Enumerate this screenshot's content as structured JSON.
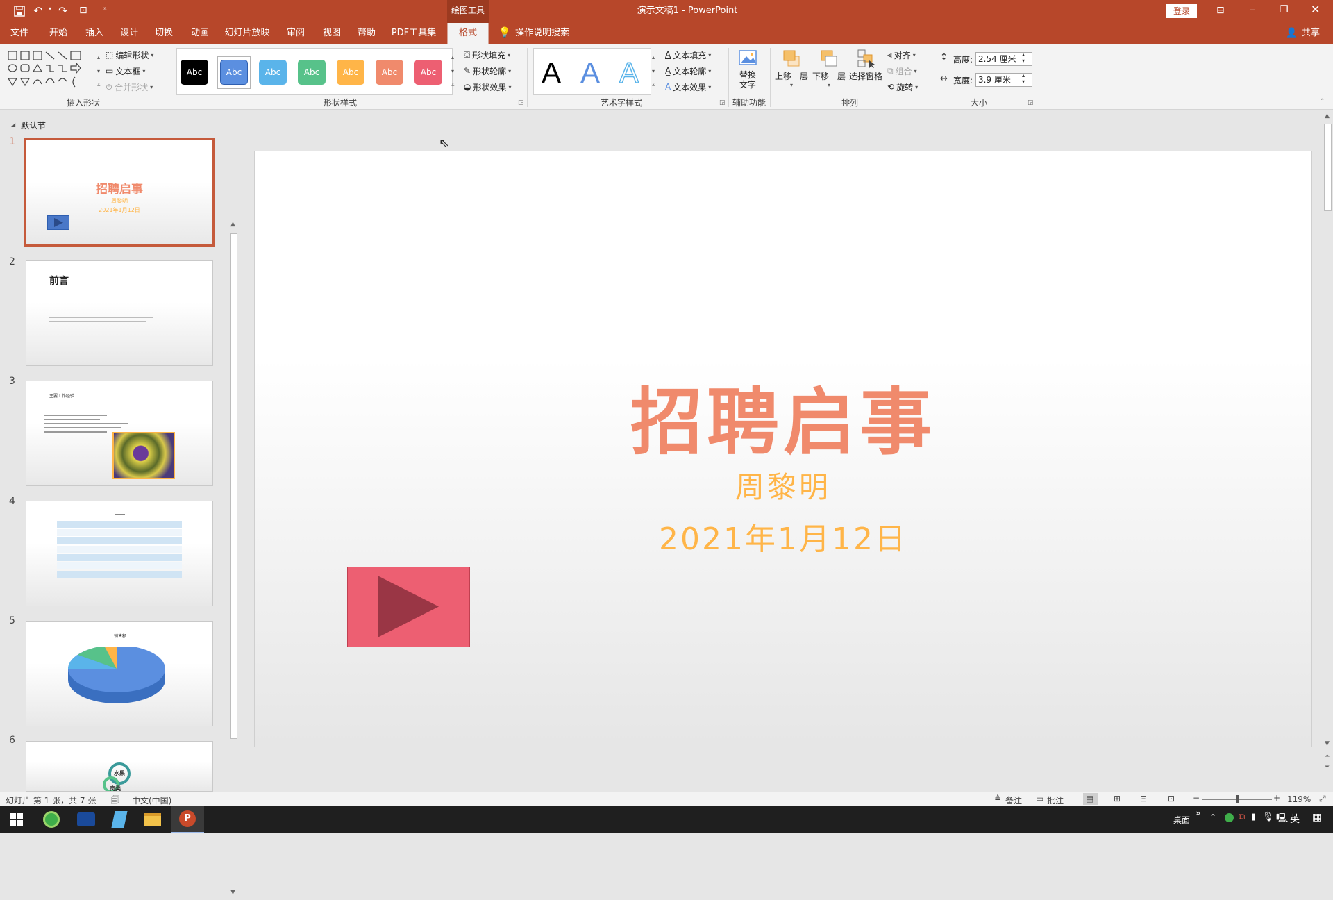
{
  "window": {
    "context_tool": "绘图工具",
    "doc_title": "演示文稿1 - PowerPoint",
    "login": "登录"
  },
  "tabs": [
    "文件",
    "开始",
    "插入",
    "设计",
    "切换",
    "动画",
    "幻灯片放映",
    "审阅",
    "视图",
    "帮助",
    "PDF工具集",
    "格式"
  ],
  "search_hint": "操作说明搜索",
  "share": "共享",
  "ribbon": {
    "insert_shapes": {
      "label": "插入形状",
      "edit_shape": "编辑形状",
      "text_box": "文本框",
      "merge_shapes": "合并形状"
    },
    "shape_styles": {
      "label": "形状样式",
      "swatch_text": "Abc",
      "swatch_colors": [
        "#000000",
        "#5b8fe0",
        "#5ab4ea",
        "#57c28a",
        "#ffb548",
        "#f08a6c",
        "#ed5f72"
      ],
      "fill": "形状填充",
      "outline": "形状轮廓",
      "effects": "形状效果"
    },
    "wordart": {
      "label": "艺术字样式",
      "letter": "A",
      "fill": "文本填充",
      "outline": "文本轮廓",
      "effects": "文本效果"
    },
    "accessibility": {
      "label": "辅助功能",
      "alt_text_1": "替换",
      "alt_text_2": "文字"
    },
    "arrange": {
      "label": "排列",
      "bring_forward": "上移一层",
      "send_backward": "下移一层",
      "selection_pane": "选择窗格",
      "align": "对齐",
      "group": "组合",
      "rotate": "旋转"
    },
    "size": {
      "label": "大小",
      "height_label": "高度:",
      "height_value": "2.54 厘米",
      "width_label": "宽度:",
      "width_value": "3.9 厘米"
    }
  },
  "thumbnails": {
    "section": "默认节",
    "nums": [
      "1",
      "2",
      "3",
      "4",
      "5",
      "6"
    ],
    "t1": {
      "title": "招聘启事",
      "name": "周黎明",
      "date": "2021年1月12日"
    },
    "t2": {
      "title": "前言"
    },
    "t3": {
      "title": "主要工作经验"
    },
    "t5": {
      "title": "销售额"
    },
    "t6": {
      "labels": [
        "水果",
        "肉类"
      ]
    }
  },
  "slide": {
    "title": "招聘启事",
    "subtitle": "周黎明",
    "date": "2021年1月12日",
    "title_color": "#f08a6c",
    "sub_color": "#ffb548",
    "shape_color": "#ed5f72"
  },
  "status": {
    "slide_info": "幻灯片 第 1 张，共 7 张",
    "language": "中文(中国)",
    "notes": "备注",
    "comments": "批注",
    "zoom": "119%"
  },
  "taskbar": {
    "desktop": "桌面",
    "ime": "英",
    "apps": [
      "start-icon",
      "browser-icon",
      "video-app-icon",
      "notes-app-icon",
      "file-explorer-icon",
      "powerpoint-icon"
    ]
  }
}
